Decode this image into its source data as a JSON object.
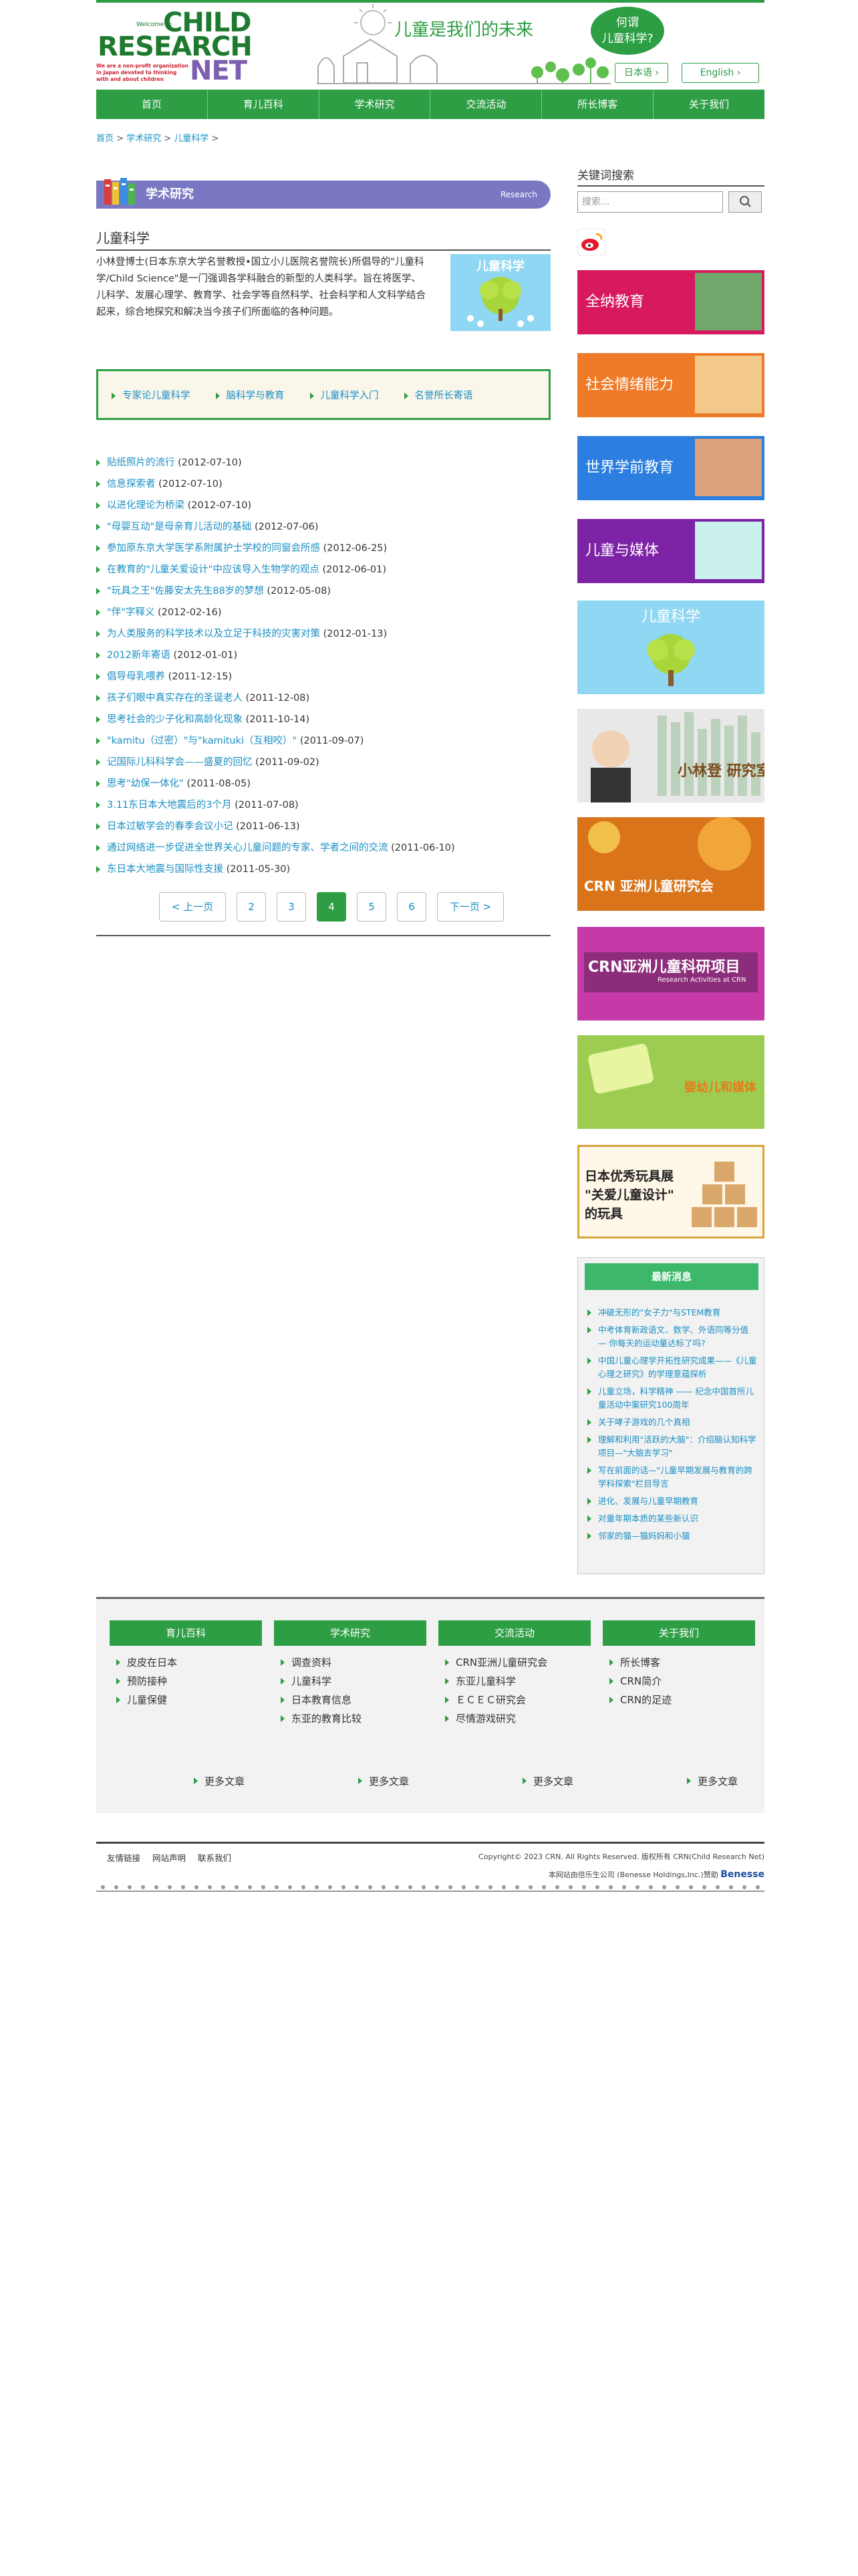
{
  "header": {
    "logo": {
      "welcome": "Welcome to",
      "l1": "CHILD",
      "l2": "RESEARCH",
      "l3": "NET",
      "tag": "We are a non-profit organization in Japan devoted to thinking with and about children"
    },
    "slogan": "儿童是我们的未来",
    "bubble_line1": "何谓",
    "bubble_line2": "儿童科学?",
    "lang_ja": "日本语 ›",
    "lang_en": "English ›"
  },
  "nav": [
    "首页",
    "育儿百科",
    "学术研究",
    "交流活动",
    "所长博客",
    "关于我们"
  ],
  "breadcrumb": [
    "首页",
    "学术研究",
    "儿童科学"
  ],
  "section": {
    "title": "学术研究",
    "en": "Research"
  },
  "page_title": "儿童科学",
  "intro": "小林登博士(日本东京大学名誉教授•国立小儿医院名誉院长)所倡导的\"儿童科学/Child Science\"是一门强调各学科融合的新型的人类科学。旨在将医学、儿科学、发展心理学、教育学、社会学等自然科学、社会科学和人文科学结合起来，综合地探究和解决当今孩子们所面临的各种问题。",
  "intro_image_text": "儿童科学",
  "topic_links": [
    "专家论儿童科学",
    "脑科学与教育",
    "儿童科学入门",
    "名誉所长寄语"
  ],
  "articles": [
    {
      "title": "贴纸照片的流行",
      "date": "(2012-07-10)"
    },
    {
      "title": "信息探索者",
      "date": "(2012-07-10)"
    },
    {
      "title": "以进化理论为桥梁",
      "date": "(2012-07-10)"
    },
    {
      "title": "\"母婴互动\"是母亲育儿活动的基础",
      "date": "(2012-07-06)"
    },
    {
      "title": "参加原东京大学医学系附属护士学校的同窗会所感",
      "date": "(2012-06-25)"
    },
    {
      "title": "在教育的\"儿童关爱设计\"中应该导入生物学的观点",
      "date": "(2012-06-01)"
    },
    {
      "title": "\"玩具之王\"佐藤安太先生88岁的梦想",
      "date": "(2012-05-08)"
    },
    {
      "title": "\"伴\"字释义",
      "date": "(2012-02-16)"
    },
    {
      "title": "为人类服务的科学技术以及立足于科技的灾害对策",
      "date": "(2012-01-13)"
    },
    {
      "title": "2012新年寄语",
      "date": "(2012-01-01)"
    },
    {
      "title": "倡导母乳喂养",
      "date": "(2011-12-15)"
    },
    {
      "title": "孩子们眼中真实存在的圣诞老人",
      "date": "(2011-12-08)"
    },
    {
      "title": "思考社会的少子化和高龄化现象",
      "date": "(2011-10-14)"
    },
    {
      "title": "\"kamitu（过密）\"与\"kamituki（互相咬）\"",
      "date": "(2011-09-07)"
    },
    {
      "title": "记国际儿科科学会——盛夏的回忆",
      "date": "(2011-09-02)"
    },
    {
      "title": "思考\"幼保一体化\"",
      "date": "(2011-08-05)"
    },
    {
      "title": "3.11东日本大地震后的3个月",
      "date": "(2011-07-08)"
    },
    {
      "title": "日本过敏学会的春季会议小记",
      "date": "(2011-06-13)"
    },
    {
      "title": "通过网络进一步促进全世界关心儿童问题的专家、学者之间的交流",
      "date": "(2011-06-10)"
    },
    {
      "title": "东日本大地震与国际性支援",
      "date": "(2011-05-30)"
    }
  ],
  "pagination": {
    "prev": "< 上一页",
    "pages": [
      "2",
      "3",
      "4",
      "5",
      "6"
    ],
    "current": "4",
    "next": "下一页 >"
  },
  "sidebar": {
    "keyword_title": "关键词搜索",
    "search_placeholder": "搜索...",
    "banners": [
      {
        "label": "全纳教育",
        "color": "#d8195f"
      },
      {
        "label": "社会情绪能力",
        "color": "#ef7a28"
      },
      {
        "label": "世界学前教育",
        "color": "#2c7fe0"
      },
      {
        "label": "儿童与媒体",
        "color": "#7d23a6"
      },
      {
        "label": "儿童科学",
        "color": "#8fd7f2"
      },
      {
        "label": "小林登 研究室",
        "color": "#e8e8e8"
      },
      {
        "label": "CRN 亚洲儿童研究会",
        "color": "#d9741a"
      },
      {
        "label": "CRN亚洲儿童科研项目",
        "sub": "Research Activities at CRN",
        "color": "#c63aa8"
      },
      {
        "label": "婴幼儿和媒体",
        "color": "#9ccd52"
      },
      {
        "label": "日本优秀玩具展 \"关爱儿童设计\" 的玩具",
        "color": "#fff7e8"
      }
    ],
    "news_title": "最新消息",
    "news": [
      "冲破无形的\"女子力\"与STEM教育",
      "中考体育新政语文、数学、外语同等分值 — 你每天的运动量达标了吗?",
      "中国儿童心理学开拓性研究成果——《儿童心理之研究》的学理意蕴探析",
      "儿童立场，科学精神 —— 纪念中国首所儿童活动中案研究100周年",
      "关于哮子游戏的几个真相",
      "理解和利用\"活跃的大脑\"：介绍脑认知科学项目—\"大脑去学习\"",
      "写在前面的话—\"儿童早期发展与教育的跨学科探索\"栏目导言",
      "进化、发展与儿童早期教育",
      "对童年期本质的某些新认识",
      "邻家的猫—猫妈妈和小猫"
    ]
  },
  "footer": {
    "columns": [
      {
        "title": "育儿百科",
        "items": [
          "皮皮在日本",
          "预防接种",
          "儿童保健"
        ]
      },
      {
        "title": "学术研究",
        "items": [
          "调查资料",
          "儿童科学",
          "日本教育信息",
          "东亚的教育比较"
        ]
      },
      {
        "title": "交流活动",
        "items": [
          "CRN亚洲儿童研究会",
          "东亚儿童科学",
          "ＥＣＥＣ研究会",
          "尽情游戏研究"
        ]
      },
      {
        "title": "关于我们",
        "items": [
          "所长博客",
          "CRN简介",
          "CRN的足迹"
        ]
      }
    ],
    "more": "更多文章",
    "bottom_links": [
      "友情链接",
      "网站声明",
      "联系我们"
    ],
    "copyright": "Copyright© 2023 CRN. All Rights Reserved. 版权所有 CRN(Child Research Net)",
    "sponsor": "本网站由倍乐生公司 (Benesse Holdings,Inc.)赞助",
    "benesse": "Benesse"
  }
}
